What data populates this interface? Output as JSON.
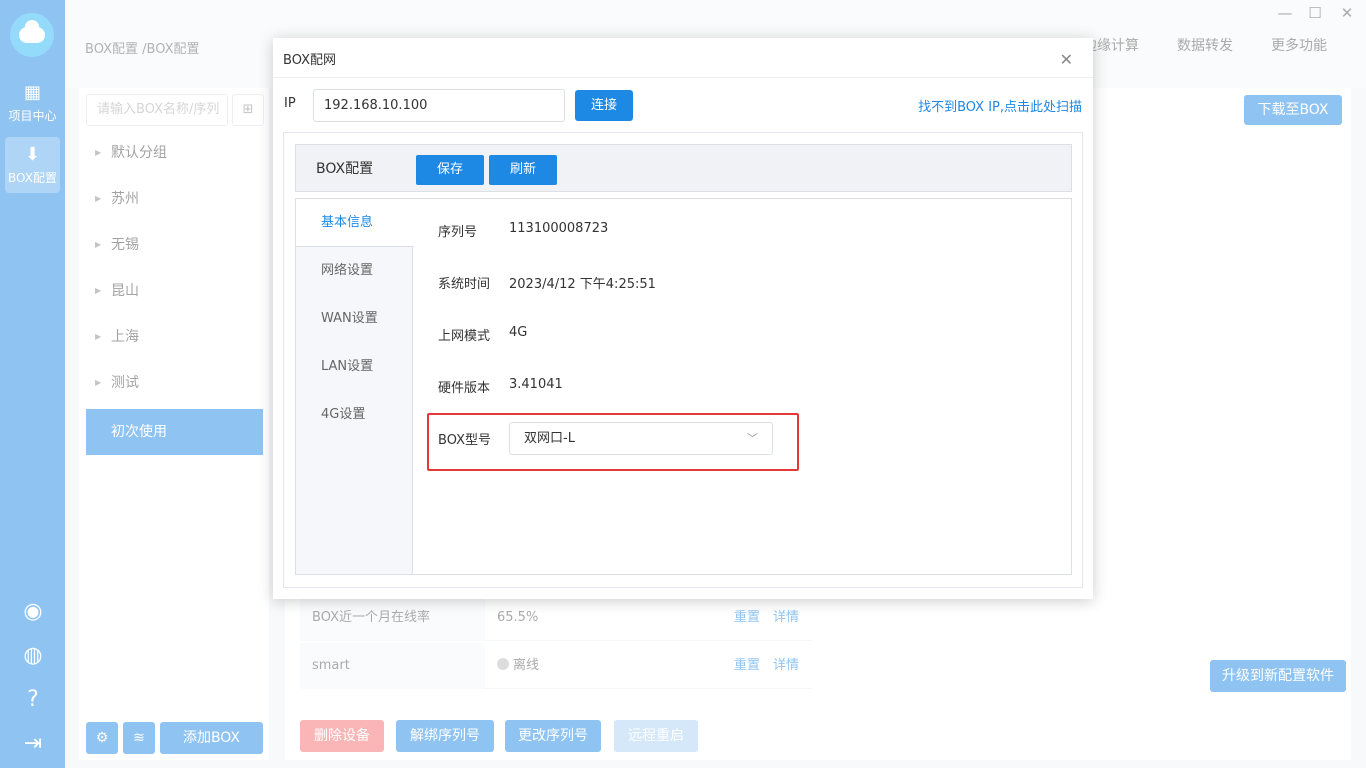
{
  "sidebar": {
    "nav": [
      {
        "label": "项目中心",
        "icon": "grid-icon"
      },
      {
        "label": "BOX配置",
        "icon": "download-icon"
      }
    ],
    "bottom_icons": [
      "user-icon",
      "globe-icon",
      "help-icon",
      "logout-icon"
    ]
  },
  "topbar": {
    "breadcrumb": "BOX配置 /BOX配置",
    "tabs": [
      "边缘计算",
      "数据转发",
      "更多功能"
    ]
  },
  "left_panel": {
    "search_placeholder": "请输入BOX名称/序列",
    "groups": [
      "默认分组",
      "苏州",
      "无锡",
      "昆山",
      "上海",
      "测试",
      "初次使用"
    ],
    "selected_group": "初次使用",
    "add_box_label": "添加BOX"
  },
  "main": {
    "download_label": "下载至BOX",
    "rows": [
      {
        "key": "BOX近一个月在线率",
        "value": "65.5%",
        "reset": "重置",
        "detail": "详情"
      },
      {
        "key": "smart",
        "value": "离线",
        "reset": "重置",
        "detail": "详情"
      }
    ],
    "upgrade_label": "升级到新配置软件",
    "actions": [
      "删除设备",
      "解绑序列号",
      "更改序列号",
      "远程重启"
    ]
  },
  "modal": {
    "title": "BOX配网",
    "ip_label": "IP",
    "ip_value": "192.168.10.100",
    "connect_label": "连接",
    "scan_link": "找不到BOX IP,点击此处扫描",
    "config_title": "BOX配置",
    "save_label": "保存",
    "refresh_label": "刷新",
    "tabs": [
      "基本信息",
      "网络设置",
      "WAN设置",
      "LAN设置",
      "4G设置"
    ],
    "active_tab": "基本信息",
    "fields": [
      {
        "label": "序列号",
        "value": "113100008723"
      },
      {
        "label": "系统时间",
        "value": "2023/4/12 下午4:25:51"
      },
      {
        "label": "上网模式",
        "value": "4G"
      },
      {
        "label": "硬件版本",
        "value": "3.41041"
      }
    ],
    "model_label": "BOX型号",
    "model_value": "双网口-L"
  },
  "colors": {
    "primary": "#1e88e5",
    "highlight_border": "#e53935",
    "danger_button": "#f56c6c"
  }
}
